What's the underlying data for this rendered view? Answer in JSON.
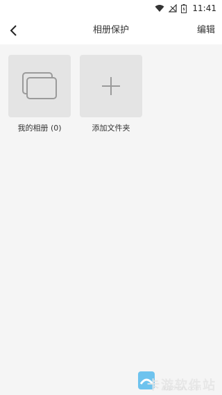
{
  "status": {
    "time": "11:41",
    "icons": [
      "wifi-icon",
      "signal-icon",
      "battery-icon"
    ]
  },
  "header": {
    "back_icon": "chevron-left-icon",
    "title": "相册保护",
    "edit_label": "编辑"
  },
  "albums": [
    {
      "label": "我的相册 (0)",
      "icon": "album-stack-icon"
    },
    {
      "label": "添加文件夹",
      "icon": "plus-icon"
    }
  ],
  "watermark": {
    "text": "卡游软件站",
    "sub": "kazhun.com"
  },
  "colors": {
    "background": "#f5f5f5",
    "tile": "#e4e4e4",
    "icon": "#9a9a9a",
    "bar": "#ffffff"
  }
}
